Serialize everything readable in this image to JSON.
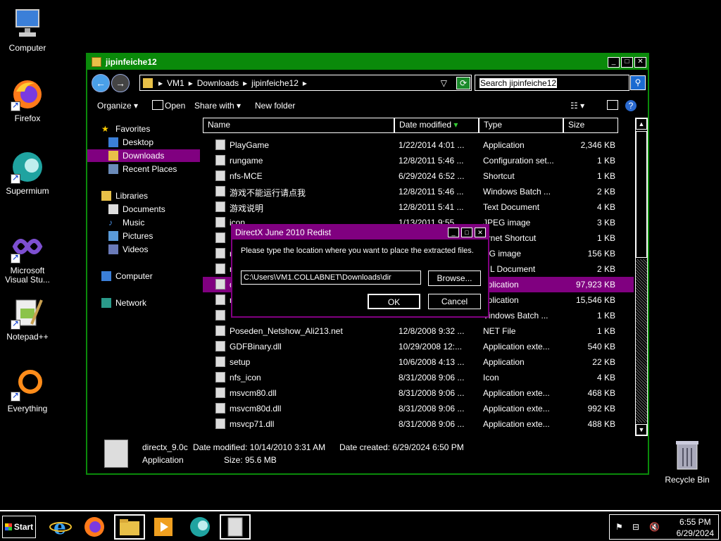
{
  "desktop": {
    "icons": [
      {
        "label": "Computer"
      },
      {
        "label": "Firefox"
      },
      {
        "label": "Supermium"
      },
      {
        "label": "Microsoft Visual Stu..."
      },
      {
        "label": "Notepad++"
      },
      {
        "label": "Everything"
      },
      {
        "label": "Recycle Bin"
      }
    ]
  },
  "window": {
    "title": "jipinfeiche12",
    "breadcrumb": [
      "VM1",
      "Downloads",
      "jipinfeiche12"
    ],
    "search_value": "Search jipinfeiche12",
    "toolbar": {
      "organize": "Organize",
      "open": "Open",
      "share": "Share with",
      "new_folder": "New folder"
    },
    "nav": {
      "favorites": "Favorites",
      "desktop": "Desktop",
      "downloads": "Downloads",
      "recent": "Recent Places",
      "libraries": "Libraries",
      "documents": "Documents",
      "music": "Music",
      "pictures": "Pictures",
      "videos": "Videos",
      "computer": "Computer",
      "network": "Network"
    },
    "columns": {
      "name": "Name",
      "date": "Date modified",
      "type": "Type",
      "size": "Size"
    },
    "files": [
      {
        "name": "PlayGame",
        "date": "1/22/2014 4:01 ...",
        "type": "Application",
        "size": "2,346 KB"
      },
      {
        "name": "rungame",
        "date": "12/8/2011 5:46 ...",
        "type": "Configuration set...",
        "size": "1 KB"
      },
      {
        "name": "nfs-MCE",
        "date": "6/29/2024 6:52 ...",
        "type": "Shortcut",
        "size": "1 KB"
      },
      {
        "name": "游戏不能运行请点我",
        "date": "12/8/2011 5:46 ...",
        "type": "Windows Batch ...",
        "size": "2 KB"
      },
      {
        "name": "游戏说明",
        "date": "12/8/2011 5:41 ...",
        "type": "Text Document",
        "size": "4 KB"
      },
      {
        "name": "icon",
        "date": "1/13/2011 9:55 ...",
        "type": "JPEG image",
        "size": "3 KB"
      },
      {
        "name": "",
        "date": "",
        "type": "ernet Shortcut",
        "size": "1 KB"
      },
      {
        "name": "n",
        "date": "",
        "type": "NG image",
        "size": "156 KB"
      },
      {
        "name": "n",
        "date": "",
        "type": "ML Document",
        "size": "2 KB"
      },
      {
        "name": "d",
        "date": "",
        "type": "pplication",
        "size": "97,923 KB"
      },
      {
        "name": "n",
        "date": "",
        "type": "pplication",
        "size": "15,546 KB"
      },
      {
        "name": "",
        "date": "",
        "type": "Vindows Batch ...",
        "size": "1 KB"
      },
      {
        "name": "Poseden_Netshow_Ali213.net",
        "date": "12/8/2008 9:32 ...",
        "type": "NET File",
        "size": "1 KB"
      },
      {
        "name": "GDFBinary.dll",
        "date": "10/29/2008 12:...",
        "type": "Application exte...",
        "size": "540 KB"
      },
      {
        "name": "setup",
        "date": "10/6/2008 4:13 ...",
        "type": "Application",
        "size": "22 KB"
      },
      {
        "name": "nfs_icon",
        "date": "8/31/2008 9:06 ...",
        "type": "Icon",
        "size": "4 KB"
      },
      {
        "name": "msvcm80.dll",
        "date": "8/31/2008 9:06 ...",
        "type": "Application exte...",
        "size": "468 KB"
      },
      {
        "name": "msvcm80d.dll",
        "date": "8/31/2008 9:06 ...",
        "type": "Application exte...",
        "size": "992 KB"
      },
      {
        "name": "msvcp71.dll",
        "date": "8/31/2008 9:06 ...",
        "type": "Application exte...",
        "size": "488 KB"
      }
    ],
    "details": {
      "name": "directx_9.0c",
      "modified": "Date modified: 10/14/2010 3:31 AM",
      "created": "Date created: 6/29/2024 6:50 PM",
      "kind": "Application",
      "size": "Size: 95.6 MB"
    }
  },
  "dialog": {
    "title": "DirectX June 2010 Redist",
    "message": "Please type the location where you want to place the extracted files.",
    "path_value": "C:\\Users\\VM1.COLLABNET\\Downloads\\dir",
    "browse": "Browse...",
    "ok": "OK",
    "cancel": "Cancel"
  },
  "taskbar": {
    "start": "Start",
    "time": "6:55 PM",
    "date": "6/29/2024"
  },
  "colors": {
    "window_border": "#0a8a0a",
    "selection": "#800080"
  }
}
